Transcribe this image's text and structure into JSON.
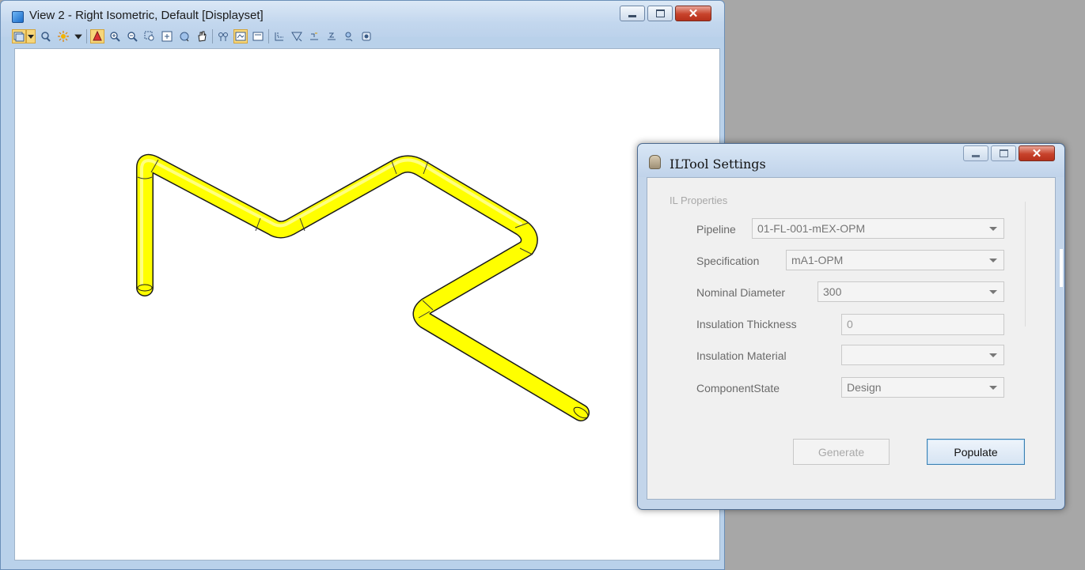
{
  "view_window": {
    "title": "View 2 - Right Isometric, Default [Displayset]",
    "toolbar_icons": [
      "view-attributes-icon",
      "dropdown-arrow-icon",
      "display-style-icon",
      "lighting-icon",
      "dropdown-arrow-icon",
      "update-view-icon",
      "zoom-in-icon",
      "zoom-out-icon",
      "window-area-icon",
      "fit-view-icon",
      "rotate-view-icon",
      "pan-view-icon",
      "view-previous-icon",
      "view-next-icon",
      "toggle-view-icon",
      "clip-volume-icon",
      "clip-mask-icon",
      "display-set-icon",
      "camera-icon",
      "change-view-perspective-icon",
      "standard-views-icon"
    ],
    "pipe_color": "#ffff00"
  },
  "dialog": {
    "title": "ILTool Settings",
    "group_label": "IL Properties",
    "fields": {
      "pipeline": {
        "label": "Pipeline",
        "value": "01-FL-001-mEX-OPM"
      },
      "specification": {
        "label": "Specification",
        "value": "mA1-OPM"
      },
      "nominal_diameter": {
        "label": "Nominal Diameter",
        "value": "300"
      },
      "insulation_thickness": {
        "label": "Insulation Thickness",
        "value": "0"
      },
      "insulation_material": {
        "label": "Insulation Material",
        "value": ""
      },
      "component_state": {
        "label": "ComponentState",
        "value": "Design"
      }
    },
    "buttons": {
      "generate": "Generate",
      "populate": "Populate"
    }
  }
}
